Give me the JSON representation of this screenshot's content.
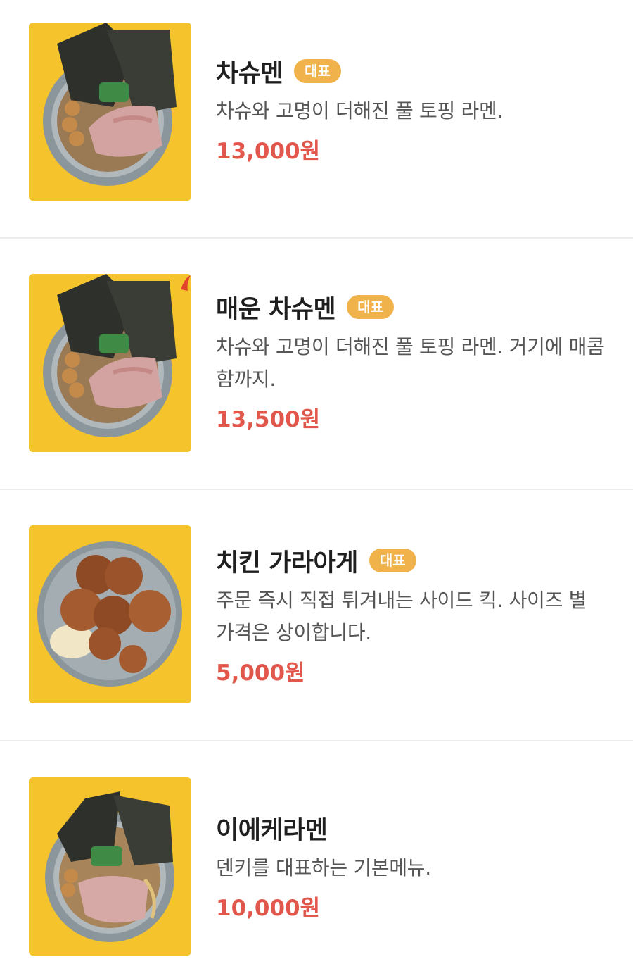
{
  "menu": {
    "items": [
      {
        "name": "차슈멘",
        "badge": "대표",
        "description": "차슈와 고명이 더해진 풀 토핑 라멘.",
        "price": "13,000원",
        "image_icon": "ramen-bowl-icon"
      },
      {
        "name": "매운 차슈멘",
        "badge": "대표",
        "description": "차슈와 고명이 더해진 풀 토핑 라멘. 거기에 매콤함까지.",
        "price": "13,500원",
        "image_icon": "spicy-ramen-bowl-icon"
      },
      {
        "name": "치킨 가라아게",
        "badge": "대표",
        "description": "주문 즉시 직접 튀겨내는 사이드 킥. 사이즈 별 가격은 상이합니다.",
        "price": "5,000원",
        "image_icon": "karaage-plate-icon"
      },
      {
        "name": "이에케라멘",
        "badge": "",
        "description": "덴키를 대표하는 기본메뉴.",
        "price": "10,000원",
        "image_icon": "ramen-bowl-icon"
      }
    ]
  },
  "colors": {
    "background_image": "#f5c42c",
    "badge": "#f0b24a",
    "price": "#e2574c",
    "title": "#1f1f1f",
    "description": "#555555"
  }
}
